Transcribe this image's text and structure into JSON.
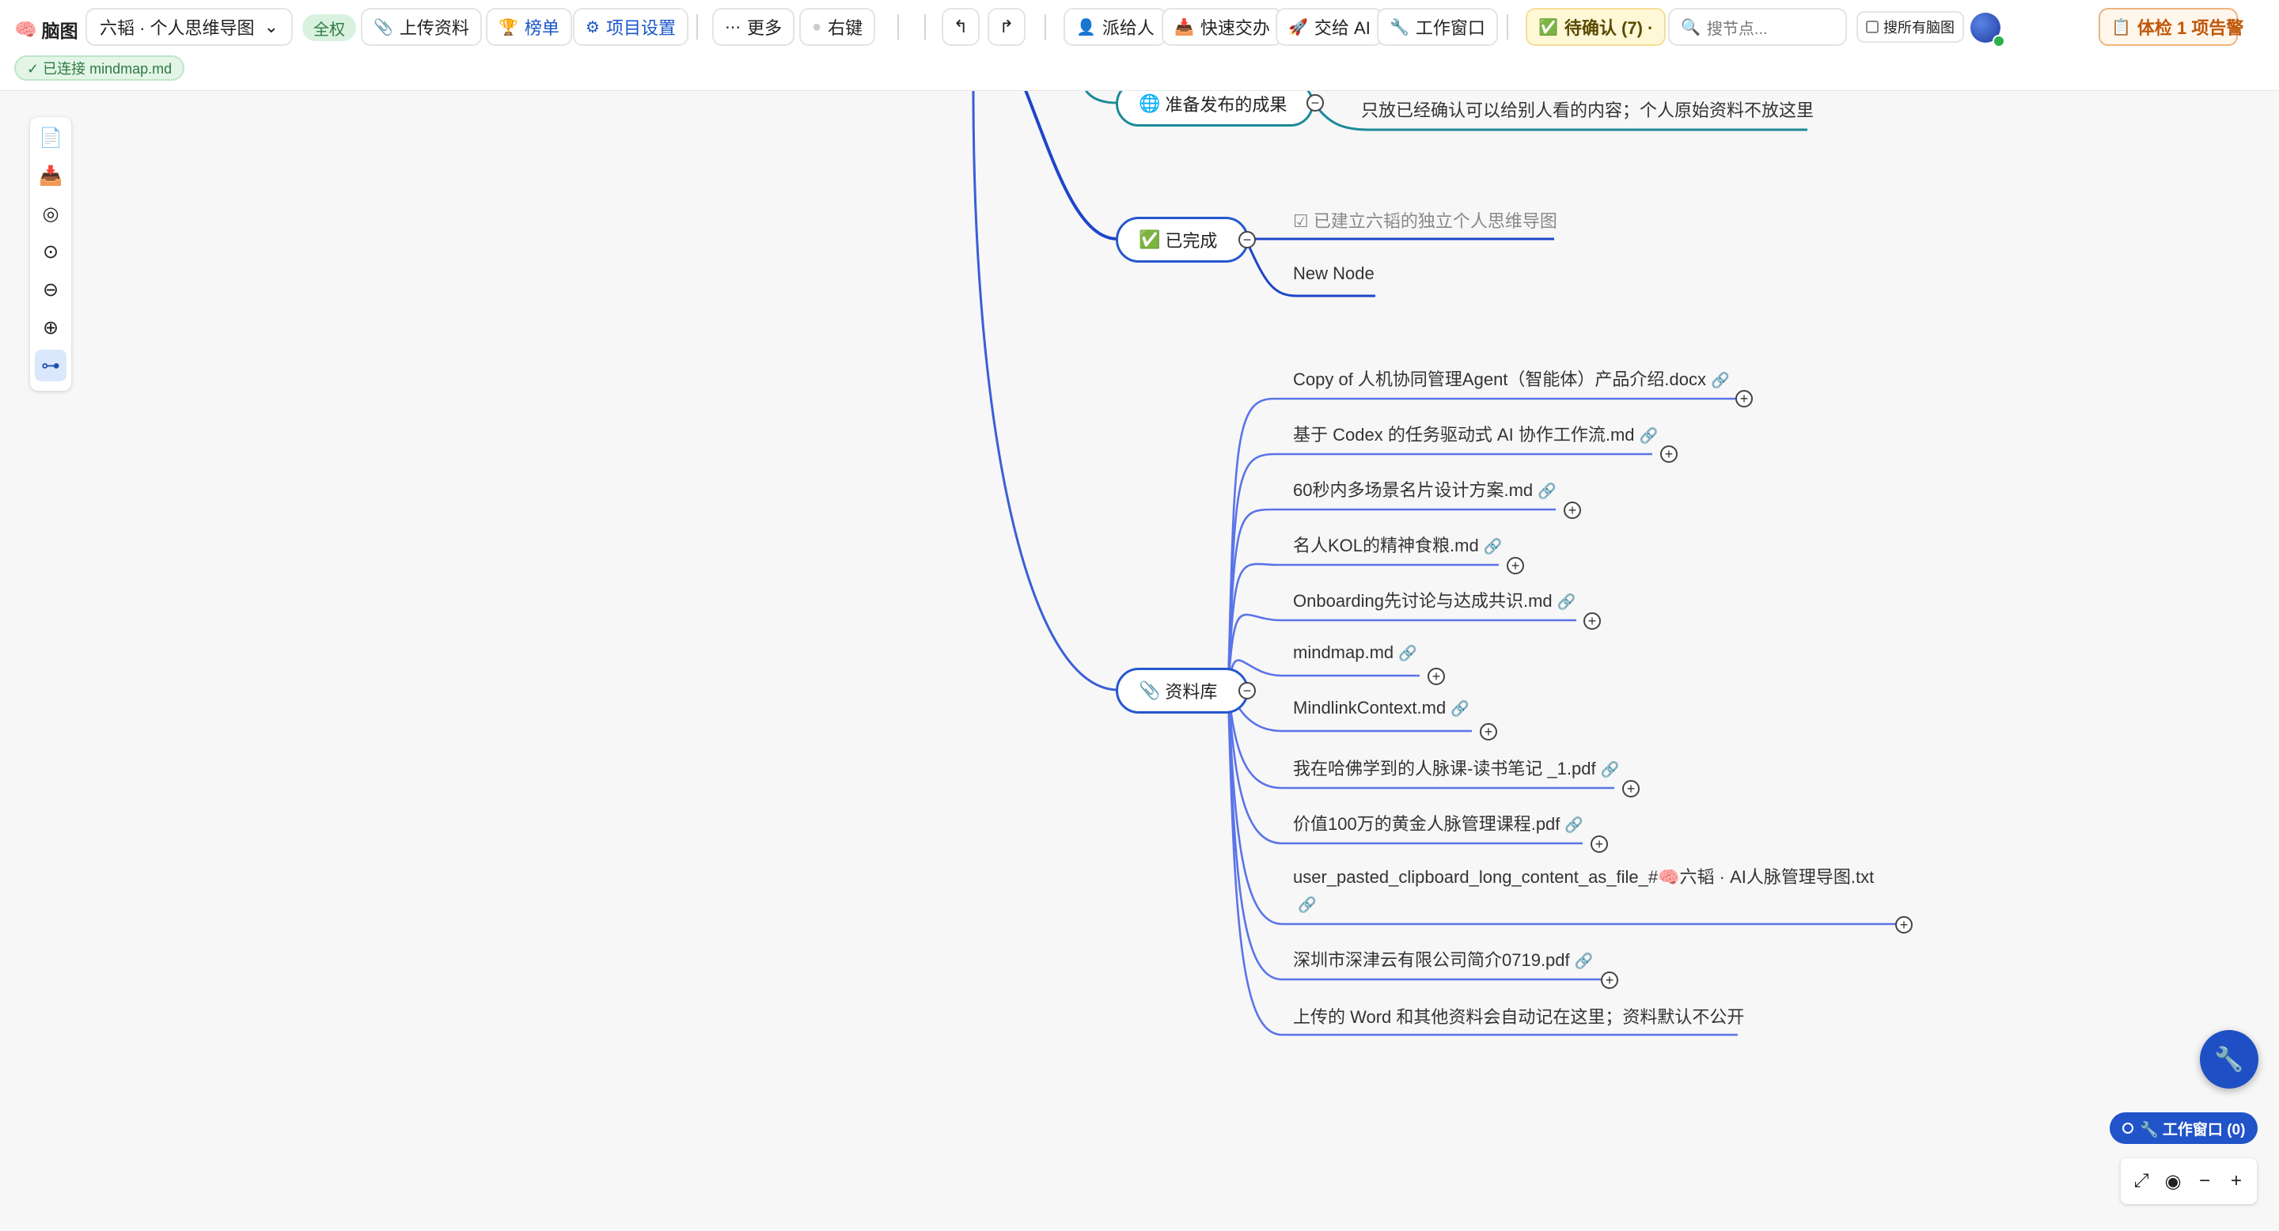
{
  "topbar": {
    "brand": "脑图",
    "project_select": "六韬 · 个人思维导图",
    "badge_full": "全权",
    "upload": "上传资料",
    "ranking": "榜单",
    "project_settings": "项目设置",
    "more": "更多",
    "right_click": "右键",
    "assign": "派给人",
    "quick_deliver": "快速交办",
    "to_ai": "交给 AI",
    "work_window": "工作窗口",
    "pending": "待确认 (7) ·",
    "search_placeholder": "搜节点...",
    "search_all": "搜所有脑图",
    "health_check": "体检 1 项告警"
  },
  "connection_badge": "✓ 已连接 mindmap.md",
  "mindmap": {
    "branches": [
      {
        "label": "准备发布的成果",
        "icon": "globe-icon",
        "children": [
          "只放已经确认可以给别人看的内容；个人原始资料不放这里"
        ]
      },
      {
        "label": "已完成",
        "icon": "check-mark-icon",
        "children": [
          "☑ 已建立六韬的独立个人思维导图",
          "New Node"
        ]
      },
      {
        "label": "资料库",
        "icon": "paperclip-icon",
        "children": [
          "Copy of 人机协同管理Agent（智能体）产品介绍.docx",
          "基于 Codex 的任务驱动式 AI 协作工作流.md",
          "60秒内多场景名片设计方案.md",
          "名人KOL的精神食粮.md",
          "Onboarding先讨论与达成共识.md",
          "mindmap.md",
          "MindlinkContext.md",
          "我在哈佛学到的人脉课-读书笔记 _1.pdf",
          "价值100万的黄金人脉管理课程.pdf",
          "user_pasted_clipboard_long_content_as_file_#🧠六韬 · AI人脉管理导图.txt",
          "深圳市深津云有限公司简介0719.pdf",
          "上传的 Word 和其他资料会自动记在这里；资料默认不公开"
        ]
      }
    ]
  },
  "bottom_right": {
    "work_window_pill": "🔧 工作窗口 (0)"
  },
  "colors": {
    "branch_blue": "#2557cc",
    "branch_teal": "#1d8a98",
    "link_line": "#4c6ef5",
    "accent": "#1f4fc4"
  }
}
